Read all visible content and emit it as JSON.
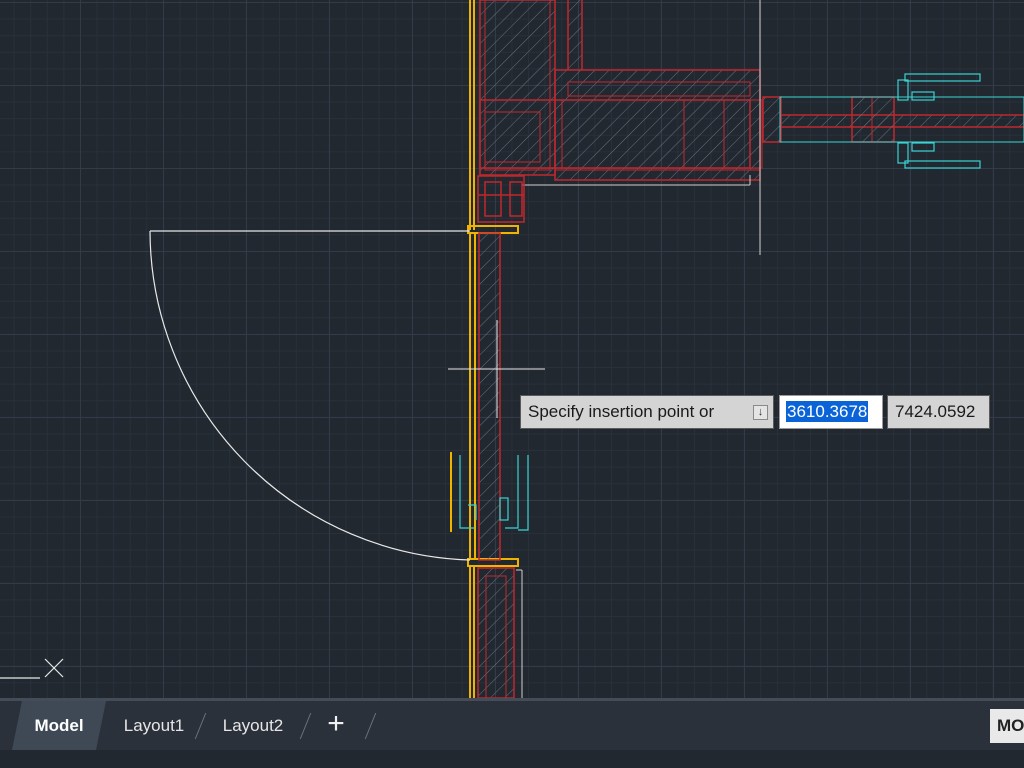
{
  "canvas": {
    "name": "Model space drawing area",
    "entities": [
      "wall-hatch",
      "door-leaf",
      "door-swing-arc",
      "door-handle",
      "crosshair-cursor",
      "ucs-icon"
    ]
  },
  "dynamic_input": {
    "prompt": "Specify insertion point or",
    "options_icon": "arrow-down-icon",
    "x_value": "3610.3678",
    "y_value": "7424.0592"
  },
  "tabs": {
    "model": "Model",
    "layout1": "Layout1",
    "layout2": "Layout2",
    "add_icon": "+"
  },
  "status": {
    "model_space": "MO"
  },
  "colors": {
    "background": "#212830",
    "wall": "#c1272d",
    "door": "#f0b400",
    "hardware": "#3bd3d3",
    "highlight": "#0a64d8"
  }
}
